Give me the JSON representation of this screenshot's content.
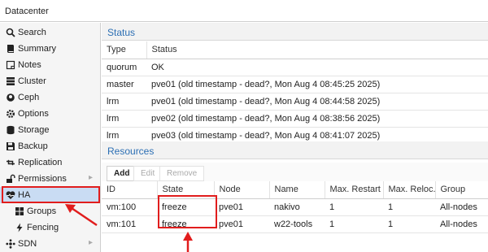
{
  "header": {
    "title": "Datacenter"
  },
  "sidebar": {
    "items": [
      {
        "label": "Search",
        "icon": "search-icon"
      },
      {
        "label": "Summary",
        "icon": "book-icon"
      },
      {
        "label": "Notes",
        "icon": "notes-icon"
      },
      {
        "label": "Cluster",
        "icon": "server-icon"
      },
      {
        "label": "Ceph",
        "icon": "ceph-icon"
      },
      {
        "label": "Options",
        "icon": "gear-icon"
      },
      {
        "label": "Storage",
        "icon": "database-icon"
      },
      {
        "label": "Backup",
        "icon": "floppy-icon"
      },
      {
        "label": "Replication",
        "icon": "retweet-icon"
      },
      {
        "label": "Permissions",
        "icon": "unlock-icon"
      },
      {
        "label": "HA",
        "icon": "heartbeat-icon"
      },
      {
        "label": "Groups",
        "icon": "groups-icon"
      },
      {
        "label": "Fencing",
        "icon": "bolt-icon"
      },
      {
        "label": "SDN",
        "icon": "sdn-icon"
      }
    ]
  },
  "status": {
    "title": "Status",
    "columns": [
      "Type",
      "Status"
    ],
    "rows": [
      [
        "quorum",
        "OK"
      ],
      [
        "master",
        "pve01 (old timestamp - dead?, Mon Aug 4 08:45:25 2025)"
      ],
      [
        "lrm",
        "pve01 (old timestamp - dead?, Mon Aug 4 08:44:58 2025)"
      ],
      [
        "lrm",
        "pve02 (old timestamp - dead?, Mon Aug 4 08:38:56 2025)"
      ],
      [
        "lrm",
        "pve03 (old timestamp - dead?, Mon Aug 4 08:41:07 2025)"
      ]
    ]
  },
  "resources": {
    "title": "Resources",
    "toolbar": {
      "add": "Add",
      "edit": "Edit",
      "remove": "Remove"
    },
    "columns": [
      "ID",
      "State",
      "Node",
      "Name",
      "Max. Restart",
      "Max. Reloc...",
      "Group"
    ],
    "rows": [
      [
        "vm:100",
        "freeze",
        "pve01",
        "nakivo",
        "1",
        "1",
        "All-nodes"
      ],
      [
        "vm:101",
        "freeze",
        "pve01",
        "w22-tools",
        "1",
        "1",
        "All-nodes"
      ]
    ]
  },
  "colors": {
    "accent": "#2c6fb4",
    "highlight": "#e11d1d",
    "selected": "#c9dcf3"
  }
}
